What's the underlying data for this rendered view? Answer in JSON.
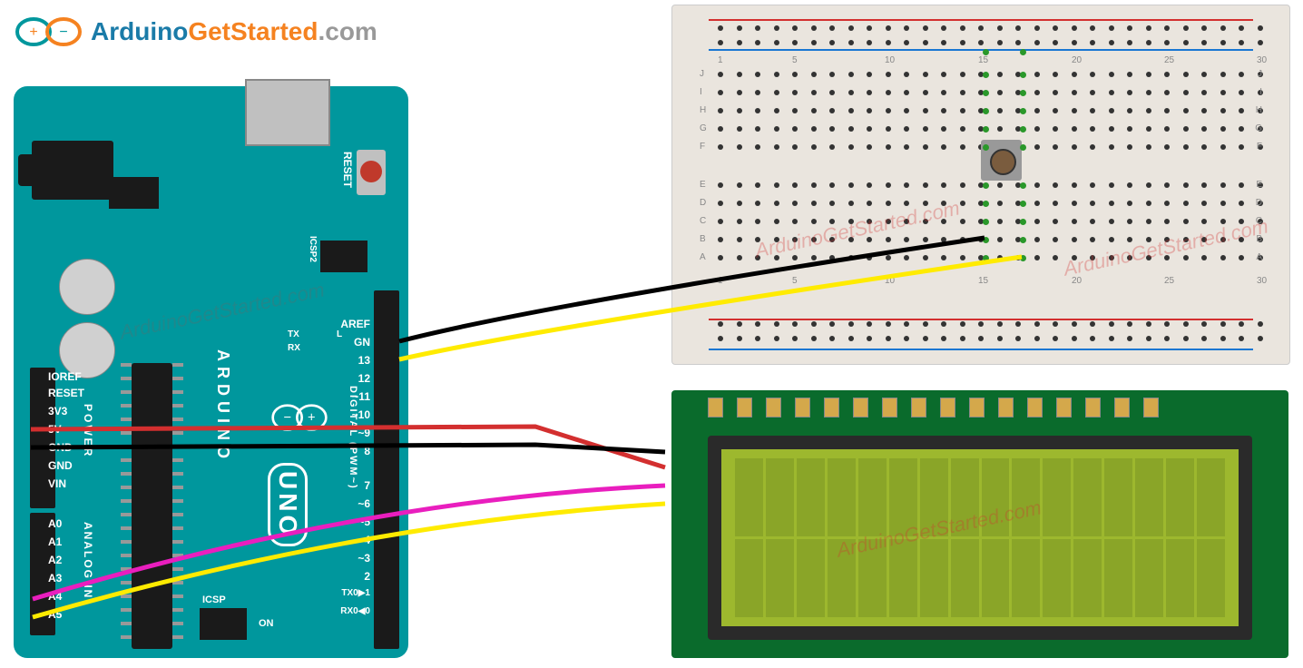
{
  "logo": {
    "text_a": "Arduino",
    "text_g": "GetStarted",
    "text_d": ".com"
  },
  "arduino": {
    "reset_label": "RESET",
    "icsp2_label": "ICSP2",
    "board_name": "ARDUINO",
    "board_variant": "UNO",
    "power_label": "POWER",
    "analog_label": "ANALOG IN",
    "digital_label": "DIGITAL (PWM~)",
    "icsp_label": "ICSP",
    "on_label": "ON",
    "tx_label": "TX",
    "rx_label": "RX",
    "l_label": "L",
    "left_pins": {
      "ioref": "IOREF",
      "reset": "RESET",
      "3v3": "3V3",
      "5v": "5V",
      "gnd1": "GND",
      "gnd2": "GND",
      "vin": "VIN",
      "a0": "A0",
      "a1": "A1",
      "a2": "A2",
      "a3": "A3",
      "a4": "A4",
      "a5": "A5"
    },
    "right_pins": {
      "aref": "AREF",
      "gnd": "GN",
      "d13": "13",
      "d12": "12",
      "d11": "~11",
      "d10": "~10",
      "d9": "~9",
      "d8": "8",
      "d7": "7",
      "d6": "~6",
      "d5": "~5",
      "d4": "4",
      "d3": "~3",
      "d2": "2",
      "tx0": "TX0▶1",
      "rx0": "RX0◀0"
    }
  },
  "breadboard": {
    "rows_top": [
      "J",
      "I",
      "H",
      "G",
      "F"
    ],
    "rows_bot": [
      "E",
      "D",
      "C",
      "B",
      "A"
    ],
    "cols": [
      "1",
      "5",
      "10",
      "15",
      "20",
      "25",
      "30"
    ]
  },
  "lcd": {
    "pin_count": 16,
    "cols": 16,
    "rows": 2
  },
  "wires": [
    {
      "name": "gnd-to-breadboard",
      "color": "#000",
      "from": "Arduino GND (digital side)",
      "to": "Breadboard A15"
    },
    {
      "name": "d13-to-breadboard",
      "color": "#ffeb00",
      "from": "Arduino D13",
      "to": "Breadboard A17"
    },
    {
      "name": "5v-to-lcd-vcc",
      "color": "#d32f2f",
      "from": "Arduino 5V",
      "to": "LCD VCC"
    },
    {
      "name": "gnd-to-lcd-gnd",
      "color": "#000",
      "from": "Arduino GND (power side)",
      "to": "LCD GND"
    },
    {
      "name": "a4-to-lcd-sda",
      "color": "#e91ebe",
      "from": "Arduino A4",
      "to": "LCD SDA"
    },
    {
      "name": "a5-to-lcd-scl",
      "color": "#ffeb00",
      "from": "Arduino A5",
      "to": "LCD SCL"
    }
  ],
  "watermarks": {
    "text": "ArduinoGetStarted.com"
  }
}
